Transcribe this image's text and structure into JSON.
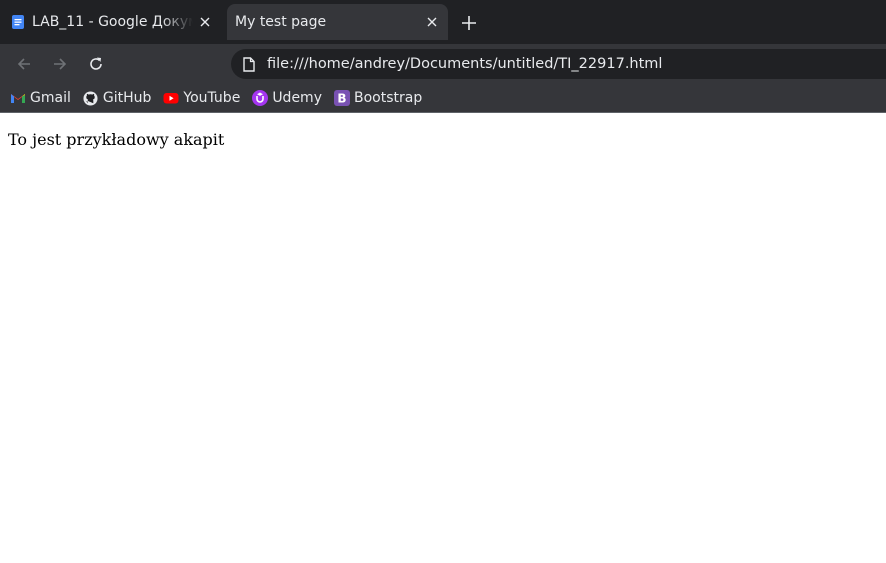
{
  "tabs": [
    {
      "title": "LAB_11 - Google Докуме",
      "icon": "google-docs-icon",
      "active": false
    },
    {
      "title": "My test page",
      "active": true
    }
  ],
  "toolbar": {
    "url": "file:///home/andrey/Documents/untitled/TI_22917.html"
  },
  "bookmarks": [
    {
      "label": "Gmail",
      "icon": "gmail-icon"
    },
    {
      "label": "GitHub",
      "icon": "github-icon"
    },
    {
      "label": "YouTube",
      "icon": "youtube-icon"
    },
    {
      "label": "Udemy",
      "icon": "udemy-icon"
    },
    {
      "label": "Bootstrap",
      "icon": "bootstrap-icon"
    }
  ],
  "page": {
    "paragraph": "To jest przykładowy akapit"
  },
  "colors": {
    "chrome_dark": "#202124",
    "chrome_mid": "#35363a",
    "text_light": "#e8eaed"
  }
}
